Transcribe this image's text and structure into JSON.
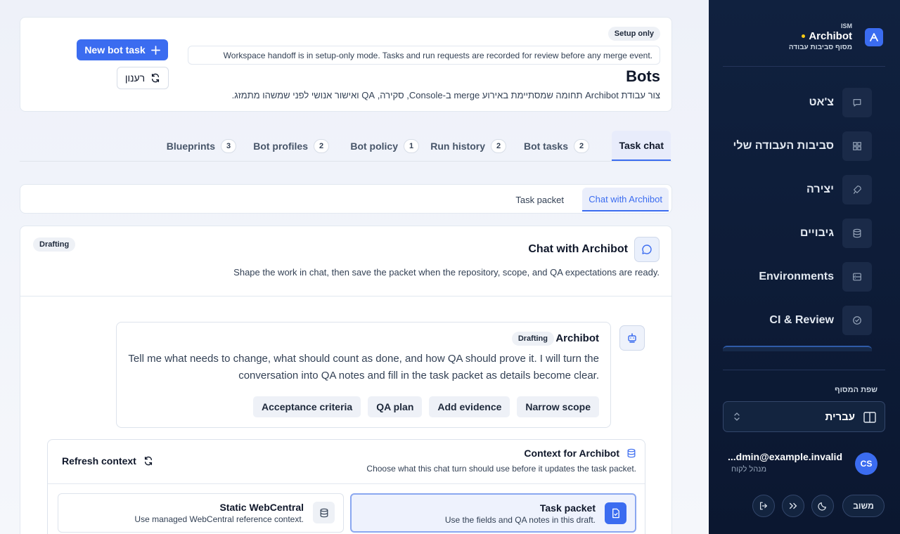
{
  "header": {
    "badge": "Setup only",
    "notice": "Workspace handoff is in setup-only mode. Tasks and run requests are recorded for review before any merge event.",
    "title": "Bots",
    "description": "צור עבודת Archibot תחומה שמסתיימת באירוע merge ב-Console, סקירה, QA ואישור אנושי לפני שמשהו מתמזג.",
    "new_task_label": "New bot task",
    "refresh_label": "רענון"
  },
  "tabs": [
    {
      "label": "Task chat",
      "count": ""
    },
    {
      "label": "Bot tasks",
      "count": "2"
    },
    {
      "label": "Run history",
      "count": "2"
    },
    {
      "label": "Bot policy",
      "count": "1"
    },
    {
      "label": "Bot profiles",
      "count": "2"
    },
    {
      "label": "Blueprints",
      "count": "3"
    }
  ],
  "subtabs": [
    "Chat with Archibot",
    "Task packet"
  ],
  "chat": {
    "title": "Chat with Archibot",
    "status": "Drafting",
    "description": "Shape the work in chat, then save the packet when the repository, scope, and QA expectations are ready.",
    "message": {
      "author": "Archibot",
      "status": "Drafting",
      "text": "Tell me what needs to change, what should count as done, and how QA should prove it. I will turn the conversation into QA notes and fill in the task packet as details become clear.",
      "chips": [
        "Acceptance criteria",
        "QA plan",
        "Add evidence",
        "Narrow scope"
      ]
    },
    "context": {
      "title": "Context for Archibot",
      "description": "Choose what this chat turn should use before it updates the task packet.",
      "refresh_label": "Refresh context",
      "options": [
        {
          "title": "Task packet",
          "desc": "Use the fields and QA notes in this draft."
        },
        {
          "title": "Static WebCentral",
          "desc": "Use managed WebCentral reference context."
        }
      ]
    }
  },
  "sidebar": {
    "brand_ism": "ISM",
    "brand_name": "Archibot",
    "brand_sub": "מסוף סביבות עבודה",
    "nav": [
      {
        "label": "צ'אט",
        "icon": "chat-icon"
      },
      {
        "label": "סביבות העבודה שלי",
        "icon": "grid-icon"
      },
      {
        "label": "יצירה",
        "icon": "rocket-icon"
      },
      {
        "label": "גיבויים",
        "icon": "database-icon"
      },
      {
        "label": "Environments",
        "icon": "server-icon"
      },
      {
        "label": "CI & Review",
        "icon": "check-circle-icon"
      }
    ],
    "language_label": "שפת המסוף",
    "language_value": "עברית",
    "user_email": "...dmin@example.invalid",
    "user_role": "מנהל לקוח",
    "user_initials": "CS",
    "feedback_label": "משוב"
  },
  "colors": {
    "accent": "#3b6cf0",
    "sidebar_bg": "#10213f",
    "dot": "#facc15"
  }
}
